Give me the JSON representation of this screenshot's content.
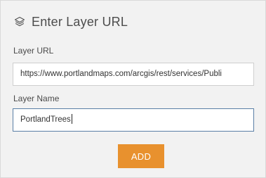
{
  "dialog": {
    "title": "Enter Layer URL",
    "title_icon": "layers-icon"
  },
  "layer_url": {
    "label": "Layer URL",
    "value": "https://www.portlandmaps.com/arcgis/rest/services/Publi"
  },
  "layer_name": {
    "label": "Layer Name",
    "value": "PortlandTrees"
  },
  "actions": {
    "add_label": "ADD"
  },
  "colors": {
    "panel_bg": "#f2f2f2",
    "add_button_bg": "#e8912e",
    "active_border": "#5a7fa6"
  }
}
